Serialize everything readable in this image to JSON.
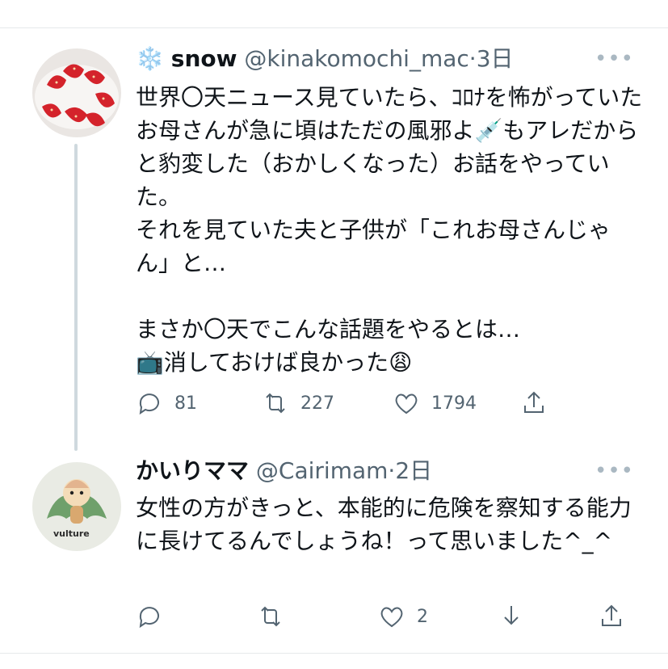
{
  "tweets": [
    {
      "emoji_prefix": "❄️",
      "display_name": "snow",
      "handle": "@kinakomochi_mac",
      "separator": "·",
      "time": "3日",
      "text": "世界〇天ニュース見ていたら、ｺﾛﾅを怖がっていたお母さんが急に頃はただの風邪よ💉もアレだからと豹変した（おかしくなった）お話をやっていた。\nそれを見ていた夫と子供が「これお母さんじゃん」と…\n\nまさか〇天でこんな話題をやるとは…\n📺消しておけば良かった😩",
      "counts": {
        "reply": "81",
        "retweet": "227",
        "like": "1794"
      }
    },
    {
      "display_name": "かいりママ",
      "handle": "@Cairimam",
      "separator": "·",
      "time": "2日",
      "text": "女性の方がきっと、本能的に危険を察知する能力に長けてるんでしょうね！って思いました^_^",
      "avatar_caption": "vulture",
      "counts": {
        "like": "2"
      }
    }
  ],
  "more_label": "•••"
}
